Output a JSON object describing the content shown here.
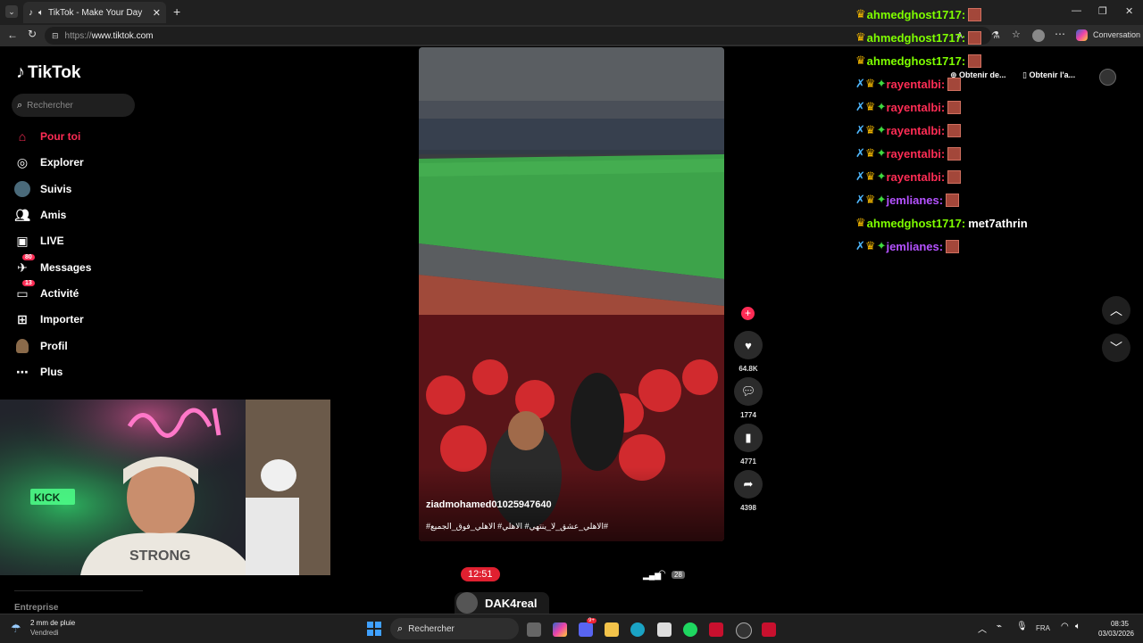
{
  "browser": {
    "tab_title": "TikTok - Make Your Day",
    "url_prefix": "https://",
    "url_host": "www.tiktok.com",
    "toolbar_buttons": [
      "Obtenir de...",
      "Obtenir l'a..."
    ],
    "copilot_label": "Conversation"
  },
  "sidebar": {
    "logo": "TikTok",
    "search_placeholder": "Rechercher",
    "items": [
      {
        "label": "Pour toi",
        "icon": "home-icon",
        "active": true
      },
      {
        "label": "Explorer",
        "icon": "compass-icon"
      },
      {
        "label": "Suivis",
        "icon": "following-avatar-icon"
      },
      {
        "label": "Amis",
        "icon": "friends-icon"
      },
      {
        "label": "LIVE",
        "icon": "live-icon"
      },
      {
        "label": "Messages",
        "icon": "messages-icon",
        "badge": "80"
      },
      {
        "label": "Activité",
        "icon": "activity-icon",
        "badge": "13"
      },
      {
        "label": "Importer",
        "icon": "upload-icon"
      },
      {
        "label": "Profil",
        "icon": "profile-icon"
      },
      {
        "label": "Plus",
        "icon": "more-icon"
      }
    ],
    "footer": "Entreprise"
  },
  "video": {
    "author": "ziadmohamed01025947640",
    "caption": "#الاهلي_عشق_لا_ينتهي# الاهلي# الاهلي_فوق_الجميع#",
    "likes": "64.8K",
    "comments": "1774",
    "saves": "4771",
    "shares": "4398",
    "phone_time": "12:51",
    "battery": "28",
    "next_author": "DAK4real"
  },
  "chat": [
    {
      "user": "ahmedghost1717:",
      "color": "#7fff00",
      "badges": "crown",
      "msg": ""
    },
    {
      "user": "ahmedghost1717:",
      "color": "#7fff00",
      "badges": "crown",
      "msg": ""
    },
    {
      "user": "ahmedghost1717:",
      "color": "#7fff00",
      "badges": "crown",
      "msg": ""
    },
    {
      "user": "rayentalbi:",
      "color": "#ff2d55",
      "badges": "full",
      "msg": ""
    },
    {
      "user": "rayentalbi:",
      "color": "#ff2d55",
      "badges": "full",
      "msg": ""
    },
    {
      "user": "rayentalbi:",
      "color": "#ff2d55",
      "badges": "full",
      "msg": ""
    },
    {
      "user": "rayentalbi:",
      "color": "#ff2d55",
      "badges": "full",
      "msg": ""
    },
    {
      "user": "rayentalbi:",
      "color": "#ff2d55",
      "badges": "full",
      "msg": ""
    },
    {
      "user": "jemlianes:",
      "color": "#b452ff",
      "badges": "full",
      "msg": ""
    },
    {
      "user": "ahmedghost1717:",
      "color": "#7fff00",
      "badges": "crown",
      "msg": "met7athrin"
    },
    {
      "user": "jemlianes:",
      "color": "#b452ff",
      "badges": "full",
      "msg": ""
    }
  ],
  "taskbar": {
    "weather_line1": "2 mm de pluie",
    "weather_line2": "Vendredi",
    "search": "Rechercher",
    "lang": "FRA",
    "time": "08:35",
    "date": "03/03/2026",
    "discord_badge": "9+"
  },
  "colors": {
    "accent": "#fe2c55",
    "crown": "#f5b800"
  }
}
